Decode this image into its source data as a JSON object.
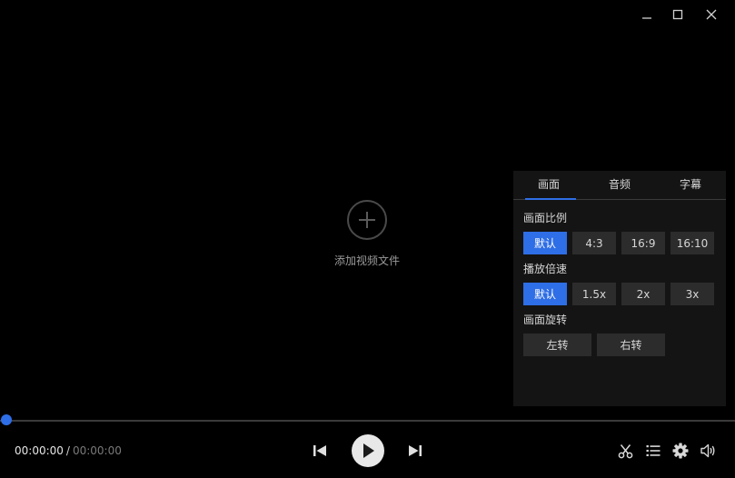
{
  "window": {
    "controls": [
      "minimize-icon",
      "maximize-icon",
      "close-icon"
    ]
  },
  "placeholder": {
    "icon": "plus-icon",
    "label": "添加视频文件"
  },
  "panel": {
    "tabs": [
      {
        "label": "画面",
        "active": true
      },
      {
        "label": "音频",
        "active": false
      },
      {
        "label": "字幕",
        "active": false
      }
    ],
    "aspect": {
      "title": "画面比例",
      "options": [
        "默认",
        "4:3",
        "16:9",
        "16:10"
      ],
      "selected": "默认"
    },
    "speed": {
      "title": "播放倍速",
      "options": [
        "默认",
        "1.5x",
        "2x",
        "3x"
      ],
      "selected": "默认"
    },
    "rotate": {
      "title": "画面旋转",
      "options": [
        "左转",
        "右转"
      ]
    }
  },
  "player": {
    "progress": 0,
    "current_time": "00:00:00",
    "separator": "/",
    "duration": "00:00:00",
    "controls": [
      "prev-icon",
      "play-icon",
      "next-icon"
    ],
    "right_tools": [
      "scissors-icon",
      "playlist-icon",
      "gear-icon",
      "volume-icon"
    ]
  },
  "colors": {
    "accent": "#2e6ee6",
    "background": "#000000",
    "panel": "#141414",
    "button": "#2c2c2c"
  }
}
